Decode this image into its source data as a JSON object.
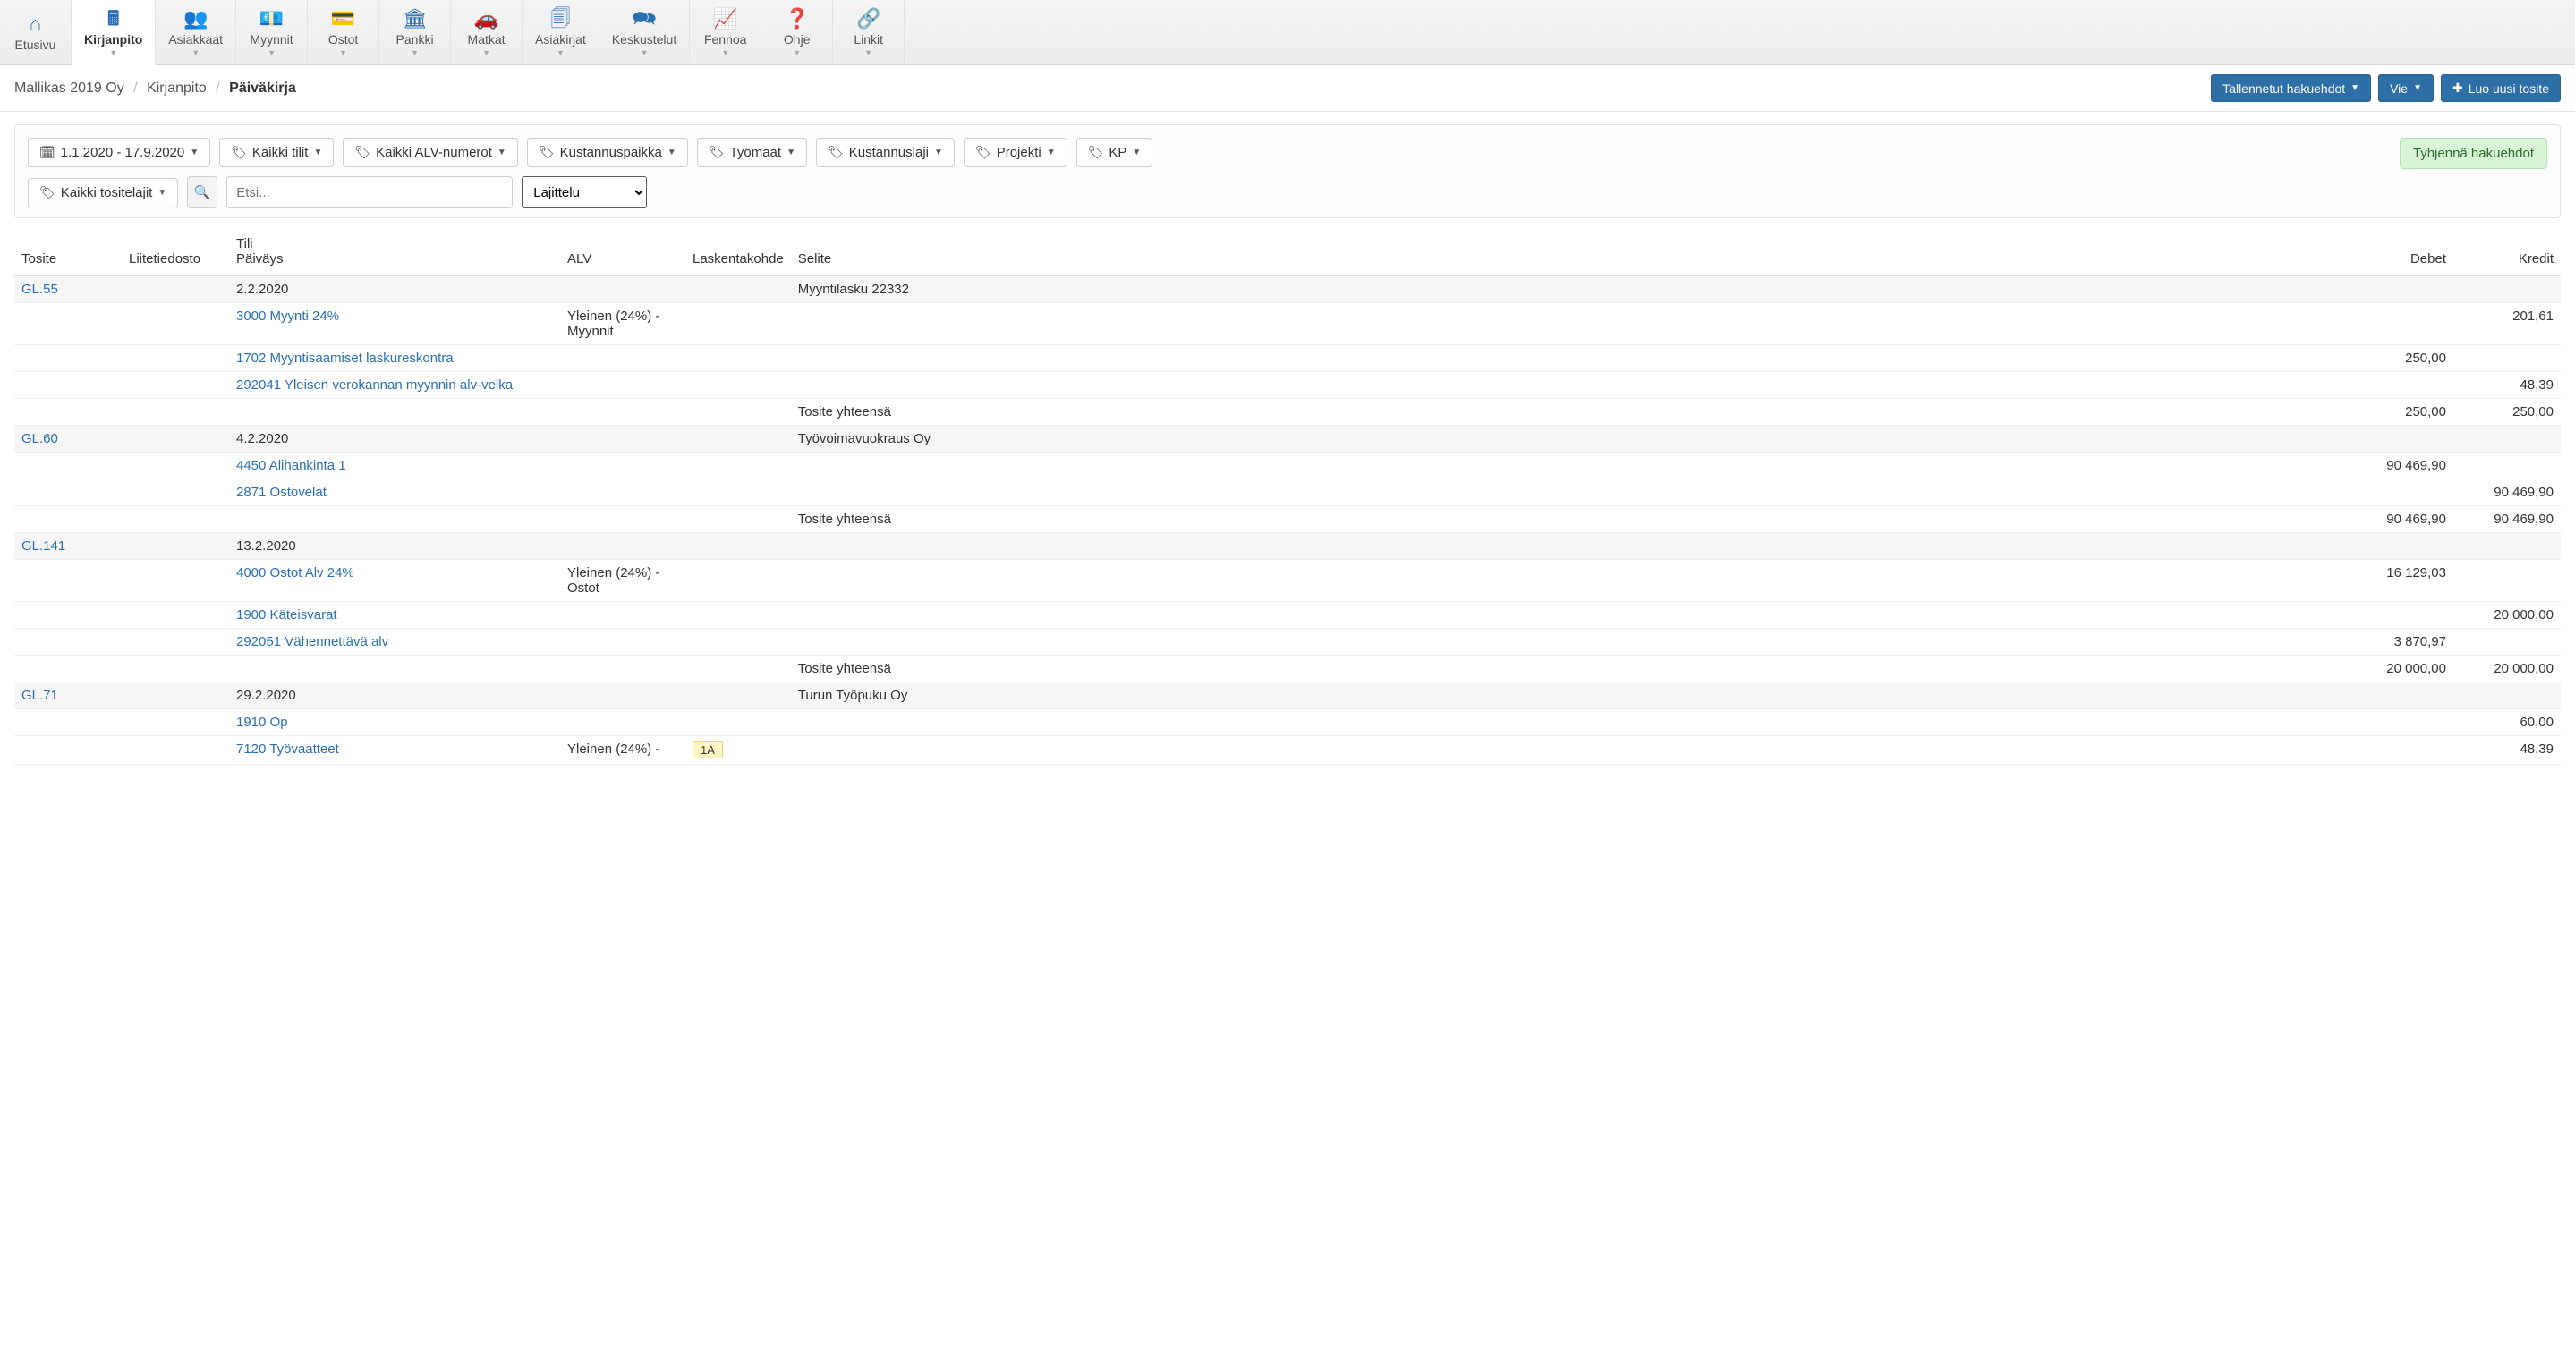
{
  "nav": [
    {
      "label": "Etusivu",
      "icon": "⌂",
      "caret": false
    },
    {
      "label": "Kirjanpito",
      "icon": "🖩",
      "caret": true,
      "active": true
    },
    {
      "label": "Asiakkaat",
      "icon": "👥",
      "caret": true
    },
    {
      "label": "Myynnit",
      "icon": "💶",
      "caret": true
    },
    {
      "label": "Ostot",
      "icon": "💳",
      "caret": true
    },
    {
      "label": "Pankki",
      "icon": "🏛",
      "caret": true
    },
    {
      "label": "Matkat",
      "icon": "🚗",
      "caret": true
    },
    {
      "label": "Asiakirjat",
      "icon": "🗐",
      "caret": true
    },
    {
      "label": "Keskustelut",
      "icon": "🗪",
      "caret": true
    },
    {
      "label": "Fennoa",
      "icon": "📈",
      "caret": true
    },
    {
      "label": "Ohje",
      "icon": "❓",
      "caret": true
    },
    {
      "label": "Linkit",
      "icon": "🔗",
      "caret": true
    }
  ],
  "breadcrumb": {
    "company": "Mallikas 2019 Oy",
    "module": "Kirjanpito",
    "page": "Päiväkirja"
  },
  "actions": {
    "saved_searches": "Tallennetut hakuehdot",
    "export": "Vie",
    "new_voucher": "Luo uusi tosite"
  },
  "filters": {
    "date_range": "1.1.2020 - 17.9.2020",
    "accounts": "Kaikki tilit",
    "vat": "Kaikki ALV-numerot",
    "cost_center": "Kustannuspaikka",
    "sites": "Työmaat",
    "cost_type": "Kustannuslaji",
    "project": "Projekti",
    "kp": "KP",
    "voucher_types": "Kaikki tositelajit",
    "search_placeholder": "Etsi...",
    "sort_placeholder": "Lajittelu",
    "clear": "Tyhjennä hakuehdot"
  },
  "table": {
    "headers": {
      "tosite": "Tosite",
      "liite": "Liitetiedosto",
      "tili": "Tili",
      "paivays": "Päiväys",
      "alv": "ALV",
      "kohde": "Laskentakohde",
      "selite": "Selite",
      "debet": "Debet",
      "kredit": "Kredit"
    },
    "rows": [
      {
        "type": "header",
        "tosite": "GL.55",
        "paivays": "2.2.2020",
        "selite": "Myyntilasku 22332"
      },
      {
        "type": "line",
        "tili": "3000 Myynti 24%",
        "alv": "Yleinen (24%) - Myynnit",
        "kredit": "201,61"
      },
      {
        "type": "line",
        "tili": "1702 Myyntisaamiset laskureskontra",
        "debet": "250,00"
      },
      {
        "type": "line",
        "tili": "292041 Yleisen verokannan myynnin alv-velka",
        "kredit": "48,39"
      },
      {
        "type": "total",
        "selite": "Tosite yhteensä",
        "debet": "250,00",
        "kredit": "250,00"
      },
      {
        "type": "header",
        "tosite": "GL.60",
        "paivays": "4.2.2020",
        "selite": "Työvoimavuokraus Oy"
      },
      {
        "type": "line",
        "tili": "4450 Alihankinta 1",
        "debet": "90 469,90"
      },
      {
        "type": "line",
        "tili": "2871 Ostovelat",
        "kredit": "90 469,90"
      },
      {
        "type": "total",
        "selite": "Tosite yhteensä",
        "debet": "90 469,90",
        "kredit": "90 469,90"
      },
      {
        "type": "header",
        "tosite": "GL.141",
        "paivays": "13.2.2020"
      },
      {
        "type": "line",
        "tili": "4000 Ostot Alv 24%",
        "alv": "Yleinen (24%) - Ostot",
        "debet": "16 129,03"
      },
      {
        "type": "line",
        "tili": "1900 Käteisvarat",
        "kredit": "20 000,00"
      },
      {
        "type": "line",
        "tili": "292051 Vähennettävä alv",
        "debet": "3 870,97"
      },
      {
        "type": "total",
        "selite": "Tosite yhteensä",
        "debet": "20 000,00",
        "kredit": "20 000,00"
      },
      {
        "type": "header",
        "tosite": "GL.71",
        "paivays": "29.2.2020",
        "selite": "Turun Työpuku Oy"
      },
      {
        "type": "line",
        "tili": "1910 Op",
        "kredit": "60,00"
      },
      {
        "type": "line",
        "tili": "7120 Työvaatteet",
        "alv": "Yleinen (24%) -",
        "kohde_badge": "1A",
        "kredit": "48.39"
      }
    ]
  }
}
